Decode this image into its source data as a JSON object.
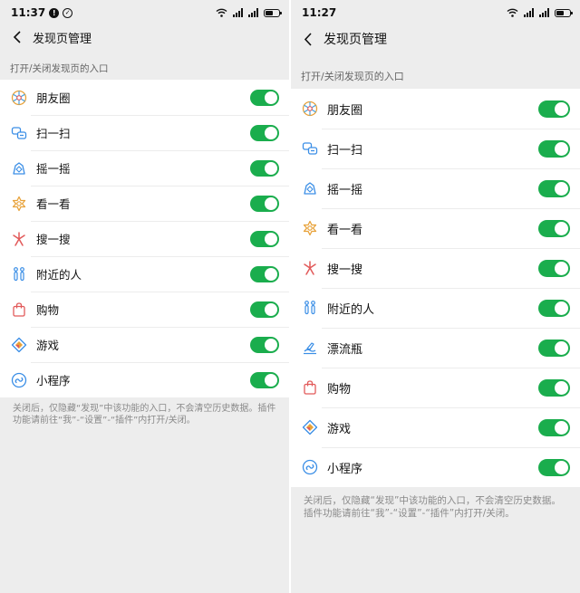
{
  "left": {
    "status": {
      "time": "11:37"
    },
    "nav": {
      "title": "发现页管理"
    },
    "section_header": "打开/关闭发现页的入口",
    "items": [
      {
        "label": "朋友圈",
        "icon": "moments-icon",
        "enabled": true
      },
      {
        "label": "扫一扫",
        "icon": "scan-icon",
        "enabled": true
      },
      {
        "label": "摇一摇",
        "icon": "shake-icon",
        "enabled": true
      },
      {
        "label": "看一看",
        "icon": "top-stories-icon",
        "enabled": true
      },
      {
        "label": "搜一搜",
        "icon": "search-icon",
        "enabled": true
      },
      {
        "label": "附近的人",
        "icon": "people-nearby-icon",
        "enabled": true
      },
      {
        "label": "购物",
        "icon": "shopping-bag-icon",
        "enabled": true
      },
      {
        "label": "游戏",
        "icon": "game-icon",
        "enabled": true
      },
      {
        "label": "小程序",
        "icon": "mini-program-icon",
        "enabled": true
      }
    ],
    "footer_note": "关闭后，仅隐藏“发现”中该功能的入口，不会清空历史数据。插件功能请前往“我”-“设置”-“插件”内打开/关闭。"
  },
  "right": {
    "status": {
      "time": "11:27"
    },
    "nav": {
      "title": "发现页管理"
    },
    "section_header": "打开/关闭发现页的入口",
    "items": [
      {
        "label": "朋友圈",
        "icon": "moments-icon",
        "enabled": true
      },
      {
        "label": "扫一扫",
        "icon": "scan-icon",
        "enabled": true
      },
      {
        "label": "摇一摇",
        "icon": "shake-icon",
        "enabled": true
      },
      {
        "label": "看一看",
        "icon": "top-stories-icon",
        "enabled": true
      },
      {
        "label": "搜一搜",
        "icon": "search-icon",
        "enabled": true
      },
      {
        "label": "附近的人",
        "icon": "people-nearby-icon",
        "enabled": true
      },
      {
        "label": "漂流瓶",
        "icon": "drift-bottle-icon",
        "enabled": true
      },
      {
        "label": "购物",
        "icon": "shopping-bag-icon",
        "enabled": true
      },
      {
        "label": "游戏",
        "icon": "game-icon",
        "enabled": true
      },
      {
        "label": "小程序",
        "icon": "mini-program-icon",
        "enabled": true
      }
    ],
    "footer_note": "关闭后，仅隐藏“发现”中该功能的入口，不会清空历史数据。插件功能请前往“我”-“设置”-“插件”内打开/关闭。"
  },
  "colors": {
    "toggle_on": "#1aad4d",
    "background": "#ededed",
    "list_background": "#ffffff"
  }
}
